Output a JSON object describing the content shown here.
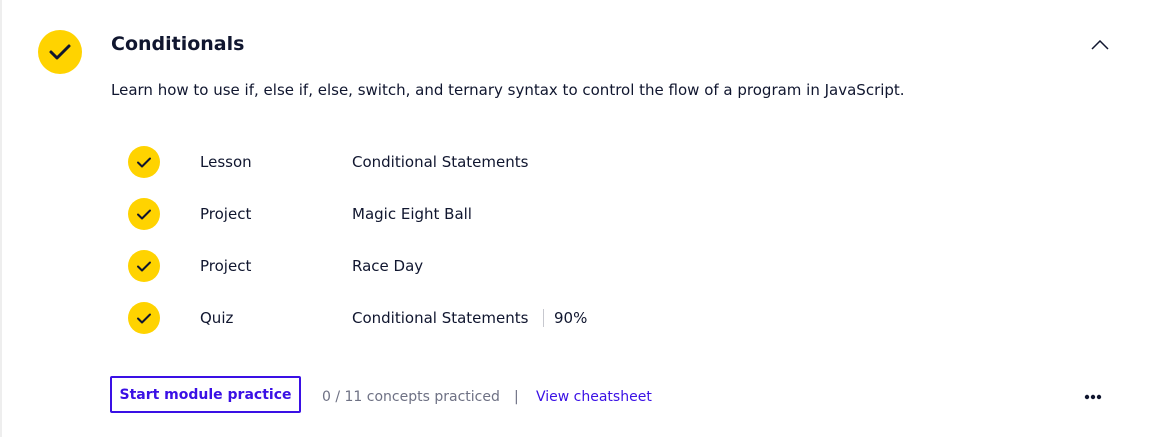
{
  "module": {
    "title": "Conditionals",
    "description": "Learn how to use if, else if, else, switch, and ternary syntax to control the flow of a program in JavaScript.",
    "completed": true,
    "expanded": true,
    "status_icon": "checkmark-icon",
    "collapse_icon": "chevron-up-icon"
  },
  "items": [
    {
      "type": "Lesson",
      "title": "Conditional Statements",
      "completed": true
    },
    {
      "type": "Project",
      "title": "Magic Eight Ball",
      "completed": true
    },
    {
      "type": "Project",
      "title": "Race Day",
      "completed": true
    },
    {
      "type": "Quiz",
      "title": "Conditional Statements",
      "score": "90%",
      "completed": true
    }
  ],
  "footer": {
    "practice_label": "Start module practice",
    "concepts_text": "0 / 11 concepts practiced",
    "separator": "|",
    "cheatsheet_label": "View cheatsheet",
    "more_icon": "more-horizontal-icon"
  },
  "colors": {
    "check_fill": "#ffd300",
    "text_primary": "#10162f",
    "text_secondary": "#6e7184",
    "accent": "#3a10e5"
  }
}
